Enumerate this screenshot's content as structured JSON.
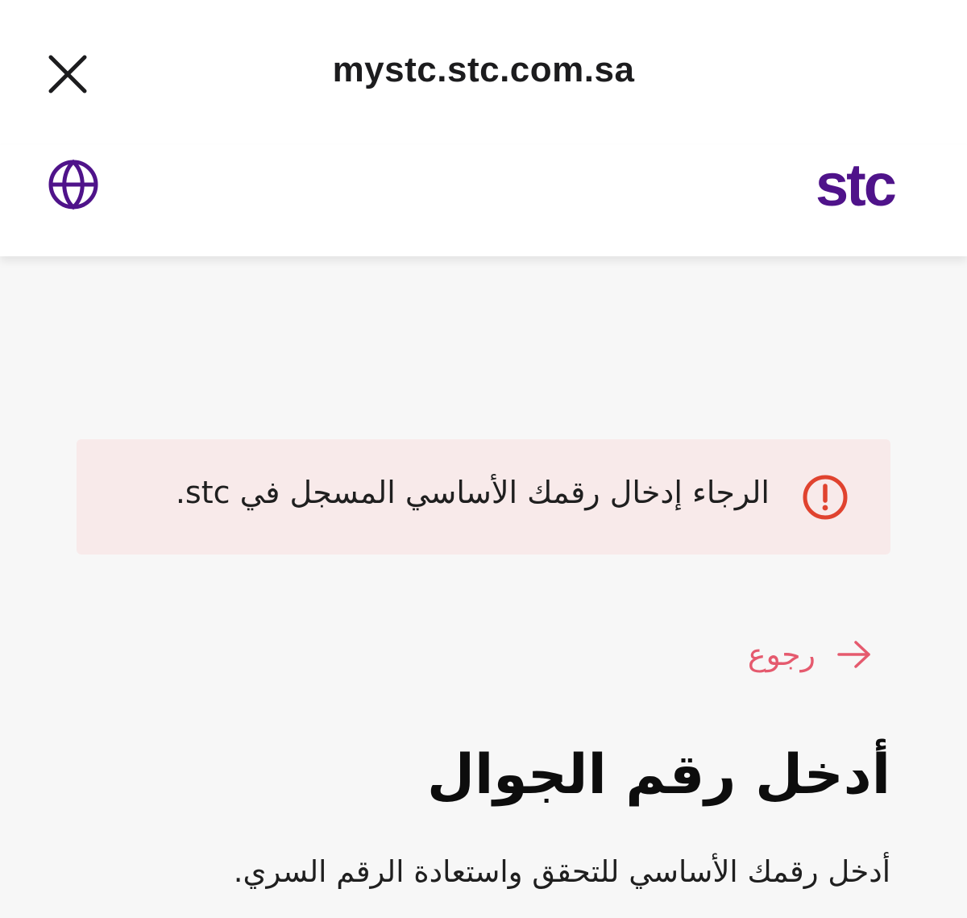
{
  "browser": {
    "url": "mystc.stc.com.sa",
    "close_icon": "close-icon"
  },
  "header": {
    "language_icon": "globe-icon",
    "logo_text": "stc",
    "brand_color": "#4f138a"
  },
  "alert": {
    "message": "الرجاء إدخال رقمك الأساسي المسجل في stc.",
    "icon": "exclamation-circle-icon",
    "icon_color": "#e0432f",
    "background": "#f8eaea"
  },
  "back": {
    "label": "رجوع",
    "icon": "arrow-right-icon",
    "color": "#e55a6e"
  },
  "main": {
    "title": "أدخل رقم الجوال",
    "subtitle": "أدخل رقمك الأساسي للتحقق واستعادة الرقم السري."
  }
}
